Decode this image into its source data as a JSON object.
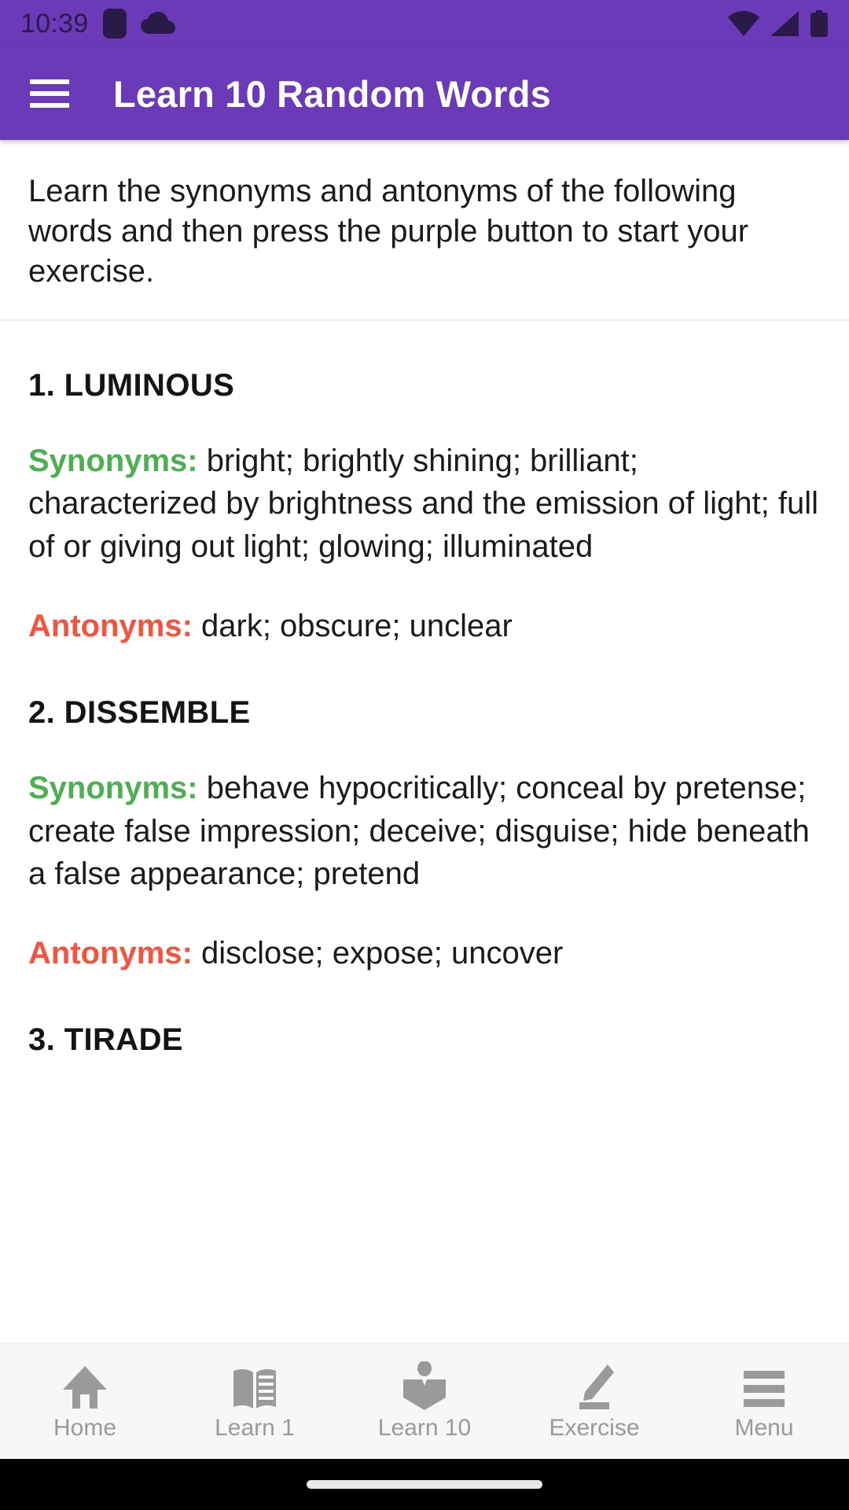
{
  "status_bar": {
    "time": "10:39",
    "icons_left": [
      "notification-square-icon",
      "cloud-icon"
    ],
    "icons_right": [
      "wifi-icon",
      "signal-icon",
      "battery-icon"
    ],
    "icon_color": "#2A1A4A"
  },
  "app_bar": {
    "menu_icon": "hamburger-menu-icon",
    "title": "Learn 10 Random Words",
    "background_color": "#6A3AB8",
    "text_color": "#FFFFFF"
  },
  "intro": {
    "text": "Learn the synonyms and antonyms of the following words and then press the purple button to start your exercise."
  },
  "labels": {
    "synonyms": "Synonyms:",
    "antonyms": "Antonyms:",
    "synonyms_color": "#4CAF50",
    "antonyms_color": "#F4533E"
  },
  "words": [
    {
      "title": "1. LUMINOUS",
      "synonyms": " bright; brightly shining; brilliant; characterized by brightness and the emission of light; full of or giving out light; glowing; illuminated",
      "antonyms": " dark; obscure; unclear"
    },
    {
      "title": "2. DISSEMBLE",
      "synonyms": " behave hypocritically; conceal by pretense; create false impression; deceive; disguise; hide beneath a false appearance; pretend",
      "antonyms": " disclose; expose; uncover"
    },
    {
      "title": "3. TIRADE",
      "synonyms": "",
      "antonyms": ""
    }
  ],
  "bottom_nav": {
    "items": [
      {
        "label": "Home",
        "icon": "home-icon"
      },
      {
        "label": "Learn 1",
        "icon": "open-book-icon"
      },
      {
        "label": "Learn 10",
        "icon": "person-reading-icon"
      },
      {
        "label": "Exercise",
        "icon": "pencil-icon"
      },
      {
        "label": "Menu",
        "icon": "hamburger-menu-icon"
      }
    ],
    "icon_color": "#9A9A9A",
    "background_color": "#F7F7F7"
  }
}
